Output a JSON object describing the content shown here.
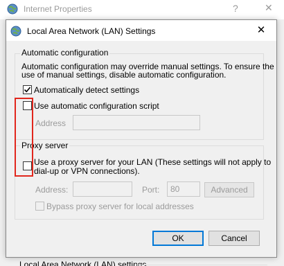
{
  "background_window": {
    "title": "Internet Properties",
    "help_glyph": "?",
    "close_glyph": "✕",
    "bottom_label": "Local Area Network (LAN) settings"
  },
  "dialog": {
    "title": "Local Area Network (LAN) Settings",
    "close_glyph": "✕",
    "automatic_configuration": {
      "group_title": "Automatic configuration",
      "description_line1": "Automatic configuration may override manual settings.  To ensure the",
      "description_line2": "use of manual settings, disable automatic configuration.",
      "auto_detect": {
        "label": "Automatically detect settings",
        "checked": true
      },
      "auto_script": {
        "label": "Use automatic configuration script",
        "checked": false
      },
      "address_label": "Address",
      "address_value": ""
    },
    "proxy_server": {
      "group_title": "Proxy server",
      "use_proxy": {
        "label_line1": "Use a proxy server for your LAN (These settings will not apply to",
        "label_line2": "dial-up or VPN connections).",
        "checked": false
      },
      "address_label": "Address:",
      "address_value": "",
      "port_label": "Port:",
      "port_value": "80",
      "advanced_label": "Advanced",
      "bypass_label": "Bypass proxy server for local addresses"
    },
    "buttons": {
      "ok": "OK",
      "cancel": "Cancel"
    }
  },
  "colors": {
    "highlight": "#e1261c",
    "accent": "#0078d7"
  }
}
